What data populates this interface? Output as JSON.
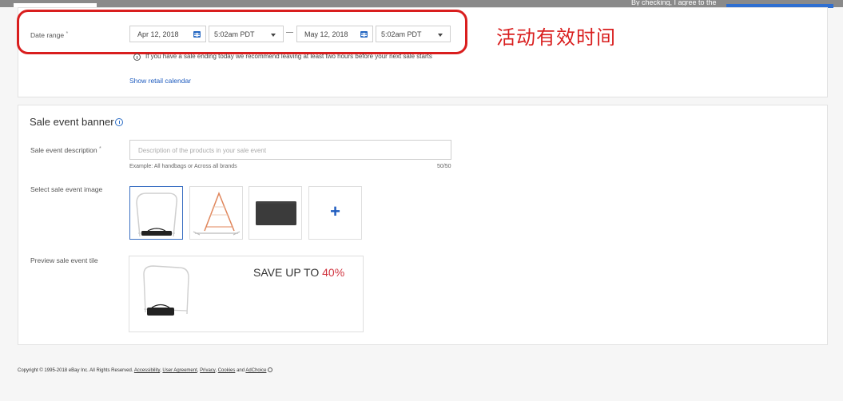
{
  "top_strip": {
    "cut_text": "By checking, I agree to the"
  },
  "date_section": {
    "label": "Date range",
    "required_mark": "*",
    "start_date": "Apr 12, 2018",
    "start_time": "5:02am PDT",
    "end_date": "May 12, 2018",
    "end_time": "5:02am PDT",
    "separator": "—",
    "note": "If you have a sale ending today we recommend leaving at least two hours before your next sale starts",
    "retail_calendar_link": "Show retail calendar"
  },
  "annotation": {
    "text": "活动有效时间",
    "color": "#d91e1e"
  },
  "banner_section": {
    "title": "Sale event banner",
    "description_label": "Sale event description",
    "description_required_mark": "*",
    "description_placeholder": "Description of the products in your sale event",
    "description_hint": "Example: All handbags or Across all brands",
    "description_count": "50/50",
    "image_label": "Select sale event image",
    "images": [
      {
        "name": "frame-net-white",
        "selected": true
      },
      {
        "name": "frame-net-orange",
        "selected": false
      },
      {
        "name": "black-bag",
        "selected": false
      }
    ],
    "add_image_label": "+",
    "preview_label": "Preview sale event tile",
    "preview_text": "SAVE UP TO",
    "preview_percent": "40%"
  },
  "footer": {
    "copyright": "Copyright © 1995-2018 eBay Inc. All Rights Reserved.",
    "links": [
      "Accessibility",
      "User Agreement",
      "Privacy",
      "Cookies"
    ],
    "and_text": "and",
    "adchoice": "AdChoice"
  },
  "colors": {
    "accent": "#1f5cbf",
    "sale_red": "#d0343f",
    "calendar_blue": "#2b6cc4"
  }
}
